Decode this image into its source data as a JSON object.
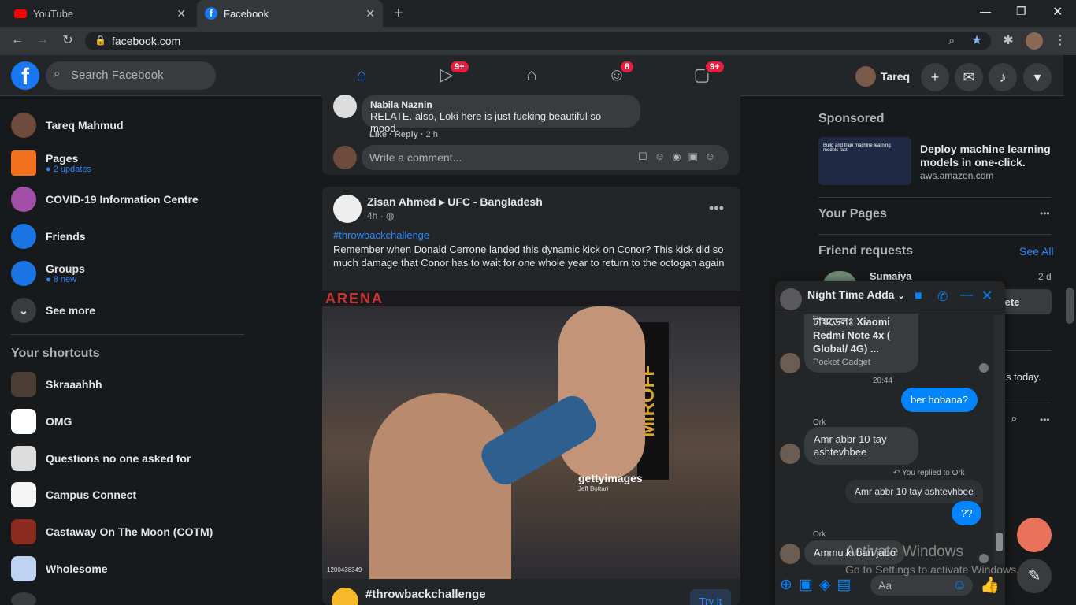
{
  "browser": {
    "tabs": [
      {
        "title": "YouTube"
      },
      {
        "title": "Facebook"
      }
    ],
    "url": "facebook.com"
  },
  "header": {
    "search_placeholder": "Search Facebook",
    "badges": {
      "watch": "9+",
      "groups": "8",
      "gaming": "9+"
    },
    "profile_name": "Tareq"
  },
  "left": {
    "items": [
      {
        "label": "Tareq Mahmud"
      },
      {
        "label": "Pages",
        "sub": "2 updates"
      },
      {
        "label": "COVID-19 Information Centre"
      },
      {
        "label": "Friends"
      },
      {
        "label": "Groups",
        "sub": "8 new"
      },
      {
        "label": "See more"
      }
    ],
    "shortcuts_title": "Your shortcuts",
    "shortcuts": [
      "Skraaahhh",
      "OMG",
      "Questions no one asked for",
      "Campus Connect",
      "Castaway On The Moon (COTM)",
      "Wholesome"
    ]
  },
  "feed": {
    "comment": {
      "author": "Nabila Naznin",
      "text": "RELATE. also, Loki here is just fucking beautiful so mood.",
      "like": "Like",
      "reply": "Reply",
      "time": "2 h"
    },
    "comment_placeholder": "Write a comment...",
    "post": {
      "author": "Zisan Ahmed",
      "group": "UFC - Bangladesh",
      "time": "4h",
      "hashtag": "#throwbackchallenge",
      "text": "Remember when Donald Cerrone landed this dynamic kick on Conor? This kick did so much damage that Conor has to wait for one whole year to return to the octogan again",
      "image_banner": "ARENA",
      "image_side": "MIROFF",
      "watermark": "gettyimages",
      "watermark_credit": "Jeff Bottari",
      "image_id": "1200438349",
      "footer_tag": "#throwbackchallenge",
      "footer_btn": "Try it"
    }
  },
  "right": {
    "sponsored": "Sponsored",
    "ad": {
      "title": "Deploy machine learning models in one-click.",
      "domain": "aws.amazon.com",
      "thumb_text": "Build and train machine learning models fast."
    },
    "your_pages": "Your Pages",
    "friend_requests": "Friend requests",
    "see_all": "See All",
    "request": {
      "name": "Sumaiya",
      "time": "2 d",
      "btn": "lete"
    },
    "birthday_fragment": "s today."
  },
  "chat": {
    "title": "Night Time Adda",
    "messages": {
      "link_preview_title": "টাস্কডেলঃ Xiaomi Redmi  Note 4x ( Global/ 4G) ...",
      "link_preview_source": "Pocket Gadget",
      "time1": "20:44",
      "mine1": "ber hobana?",
      "sender1": "Ork",
      "ork1": "Amr abbr 10 tay ashtevhbee",
      "replied_to": "You replied to Ork",
      "quoted": "Amr abbr 10 tay ashtevhbee",
      "mine2": "??",
      "sender2": "Ork",
      "ork2": "Ammu ki bari jabo"
    },
    "input_placeholder": "Aa"
  },
  "watermark": {
    "line1": "Activate Windows",
    "line2": "Go to Settings to activate Windows."
  }
}
